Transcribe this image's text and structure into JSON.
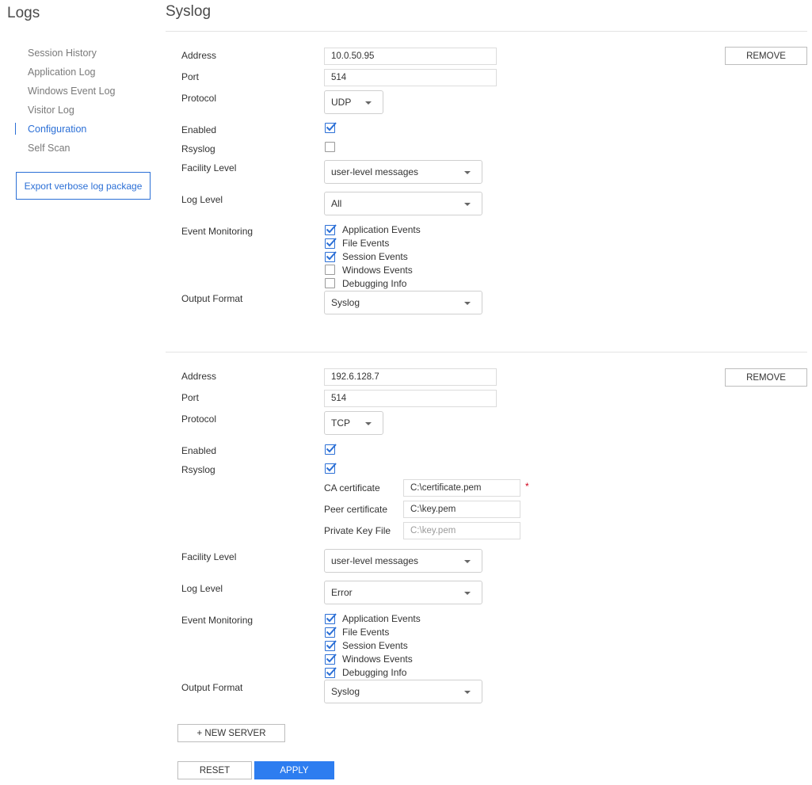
{
  "sidebar": {
    "title": "Logs",
    "items": [
      {
        "label": "Session History"
      },
      {
        "label": "Application Log"
      },
      {
        "label": "Windows Event Log"
      },
      {
        "label": "Visitor Log"
      },
      {
        "label": "Configuration"
      },
      {
        "label": "Self Scan"
      }
    ],
    "active_item": "Configuration",
    "export_button": "Export verbose log package"
  },
  "page": {
    "title": "Syslog"
  },
  "labels": {
    "address": "Address",
    "port": "Port",
    "protocol": "Protocol",
    "enabled": "Enabled",
    "rsyslog": "Rsyslog",
    "facility_level": "Facility Level",
    "log_level": "Log Level",
    "event_monitoring": "Event Monitoring",
    "output_format": "Output Format",
    "remove": "REMOVE",
    "ca_certificate": "CA certificate",
    "peer_certificate": "Peer certificate",
    "private_key_file": "Private Key File",
    "required_mark": "*"
  },
  "servers": [
    {
      "address": "10.0.50.95",
      "port": "514",
      "protocol": "UDP",
      "enabled": true,
      "rsyslog": false,
      "facility_level": "user-level messages",
      "log_level": "All",
      "events": [
        {
          "label": "Application Events",
          "checked": true
        },
        {
          "label": "File Events",
          "checked": true
        },
        {
          "label": "Session Events",
          "checked": true
        },
        {
          "label": "Windows Events",
          "checked": false
        },
        {
          "label": "Debugging Info",
          "checked": false
        }
      ],
      "output_format": "Syslog"
    },
    {
      "address": "192.6.128.7",
      "port": "514",
      "protocol": "TCP",
      "enabled": true,
      "rsyslog": true,
      "ca_certificate": "C:\\certificate.pem",
      "peer_certificate": "C:\\key.pem",
      "private_key_placeholder": "C:\\key.pem",
      "facility_level": "user-level messages",
      "log_level": "Error",
      "events": [
        {
          "label": "Application Events",
          "checked": true
        },
        {
          "label": "File Events",
          "checked": true
        },
        {
          "label": "Session Events",
          "checked": true
        },
        {
          "label": "Windows Events",
          "checked": true
        },
        {
          "label": "Debugging Info",
          "checked": true
        }
      ],
      "output_format": "Syslog"
    }
  ],
  "actions": {
    "new_server": "+ NEW SERVER",
    "reset": "RESET",
    "apply": "APPLY"
  },
  "colors": {
    "accent": "#2b6fd6",
    "primary_button": "#2d7df0",
    "required": "#d0021b"
  }
}
